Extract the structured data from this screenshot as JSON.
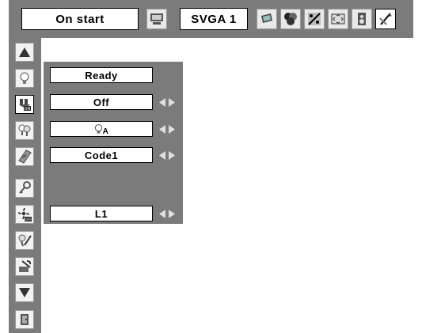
{
  "topbar": {
    "mode_label": "On start",
    "signal_label": "SVGA 1",
    "icons": [
      "input-icon",
      "display-icon",
      "color-icon",
      "image-adjust-icon",
      "screen-icon",
      "sound-icon",
      "setting-icon"
    ]
  },
  "sidebar": {
    "items": [
      "up-arrow-icon",
      "lamp-icon",
      "power-management-icon",
      "lamp-mode-icon",
      "remote-control-icon",
      "security-lock-icon",
      "fan-off-icon",
      "filter-icon",
      "factory-default-icon",
      "down-arrow-icon",
      "exit-icon"
    ]
  },
  "panel": {
    "rows": [
      {
        "value": "Ready"
      },
      {
        "value": "Off"
      },
      {
        "value": "A"
      },
      {
        "value": "Code1"
      },
      {
        "value": "L1"
      }
    ]
  },
  "colors": {
    "menu_background": "#7b7b7b",
    "field_background": "#ffffff"
  }
}
